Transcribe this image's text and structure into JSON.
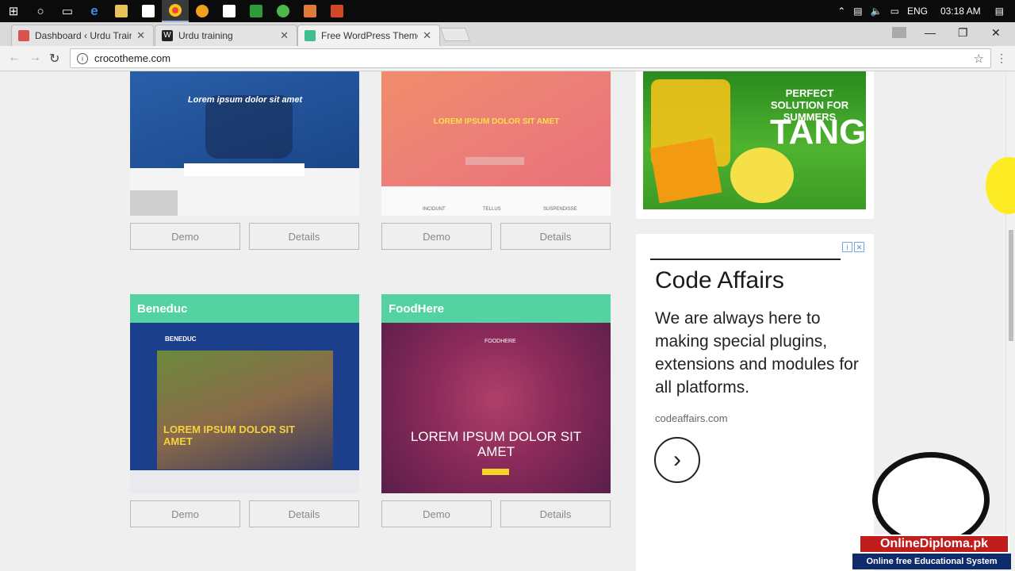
{
  "taskbar": {
    "icons": [
      "windows-start-icon",
      "cortana-icon",
      "task-view-icon",
      "edge-icon",
      "file-explorer-icon",
      "store-icon",
      "chrome-icon",
      "app-icon",
      "app-icon",
      "app-icon",
      "app-icon",
      "app-icon",
      "powerpoint-icon"
    ],
    "language": "ENG",
    "time": "03:18 AM"
  },
  "tabs": [
    {
      "title": "Dashboard ‹ Urdu Trainin"
    },
    {
      "title": "Urdu training"
    },
    {
      "title": "Free WordPress Themes"
    }
  ],
  "address_bar": {
    "url": "crocotheme.com"
  },
  "themes": [
    {
      "title": "",
      "demo": "Demo",
      "details": "Details",
      "hero_text": "Lorem ipsum dolor sit amet"
    },
    {
      "title": "",
      "demo": "Demo",
      "details": "Details",
      "hero_text": "LOREM IPSUM DOLOR SIT AMET",
      "feature_labels": [
        "INCIDUNT",
        "TELLUS",
        "SUSPENDISSE"
      ]
    },
    {
      "title": "Beneduc",
      "demo": "Demo",
      "details": "Details",
      "hero_text": "LOREM IPSUM DOLOR SIT AMET",
      "logo": "BENEDUC"
    },
    {
      "title": "FoodHere",
      "demo": "Demo",
      "details": "Details",
      "hero_text": "LOREM IPSUM DOLOR SIT AMET",
      "logo": "FOODHERE"
    }
  ],
  "ads": {
    "tang": {
      "headline": "PERFECT SOLUTION FOR SUMMERS",
      "brand": "TANG"
    },
    "code_affairs": {
      "title": "Code Affairs",
      "body": "We are always here to making special plugins, extensions and modules for all platforms.",
      "url": "codeaffairs.com"
    }
  },
  "watermark": {
    "name": "OnlineDiploma.pk",
    "tagline": "Online free Educational System"
  },
  "colors": {
    "card_title_bg": "#55d2a2",
    "tang_green": "#3b9a25",
    "brand_red": "#c21d1d",
    "brand_navy": "#0e2b6b"
  }
}
